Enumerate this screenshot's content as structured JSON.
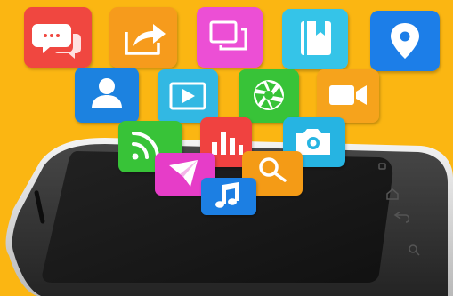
{
  "scene": {
    "background_color": "#fbb612",
    "phone": {
      "body_color": "#2f2f2f",
      "screen_color": "#151515",
      "frame_color": "#d7d7d7",
      "buttons": [
        "menu-icon",
        "home-icon",
        "back-icon",
        "search-icon"
      ]
    },
    "app_tiles": [
      {
        "icon": "chat-bubbles-icon",
        "color": "#f0463f"
      },
      {
        "icon": "share-arrow-icon",
        "color": "#f69b1a"
      },
      {
        "icon": "windows-icon",
        "color": "#ec4fd5"
      },
      {
        "icon": "notebook-icon",
        "color": "#34c4e8"
      },
      {
        "icon": "map-pin-icon",
        "color": "#1f7ee8"
      },
      {
        "icon": "contact-icon",
        "color": "#1c82e0"
      },
      {
        "icon": "video-play-icon",
        "color": "#33b8e3"
      },
      {
        "icon": "camera-aperture-icon",
        "color": "#37c338"
      },
      {
        "icon": "video-camera-icon",
        "color": "#f6a31d"
      },
      {
        "icon": "rss-feed-icon",
        "color": "#37c338"
      },
      {
        "icon": "bar-chart-icon",
        "color": "#f0433f"
      },
      {
        "icon": "camera-icon",
        "color": "#27b4e2"
      },
      {
        "icon": "paper-plane-icon",
        "color": "#e63cc8"
      },
      {
        "icon": "magnifier-icon",
        "color": "#f49b16"
      },
      {
        "icon": "music-note-icon",
        "color": "#1d7fe3"
      }
    ]
  }
}
